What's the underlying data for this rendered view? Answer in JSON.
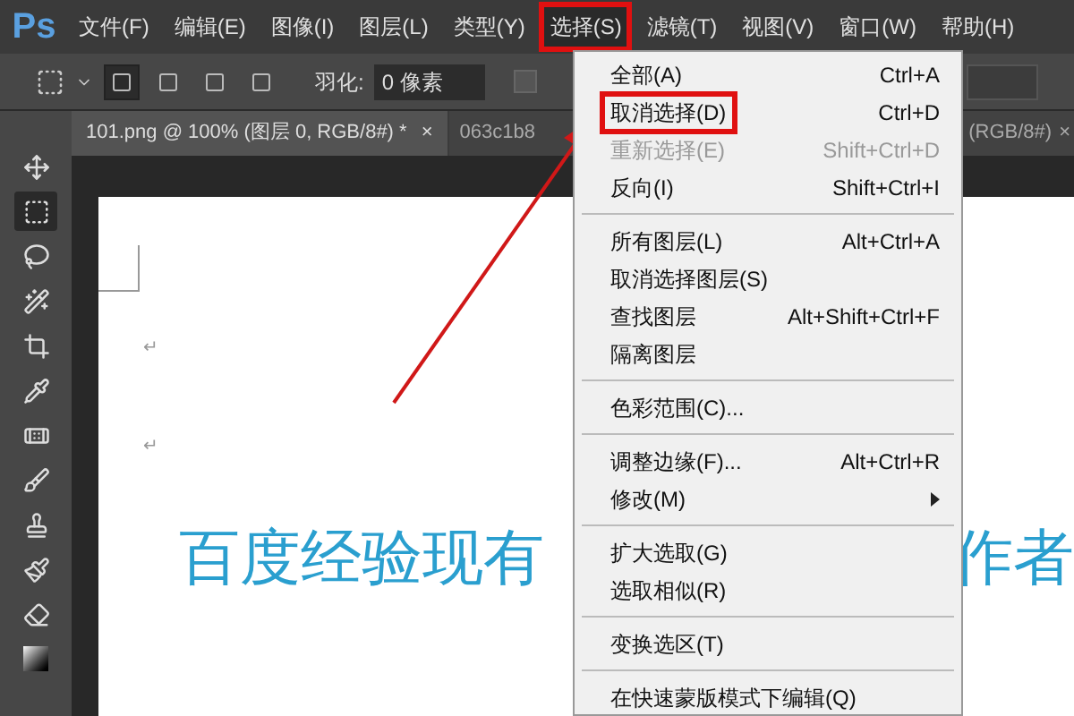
{
  "app_logo": "Ps",
  "menu_bar": [
    {
      "label": "文件(F)",
      "selected": false,
      "highlighted": false
    },
    {
      "label": "编辑(E)",
      "selected": false,
      "highlighted": false
    },
    {
      "label": "图像(I)",
      "selected": false,
      "highlighted": false
    },
    {
      "label": "图层(L)",
      "selected": false,
      "highlighted": false
    },
    {
      "label": "类型(Y)",
      "selected": false,
      "highlighted": false
    },
    {
      "label": "选择(S)",
      "selected": true,
      "highlighted": true
    },
    {
      "label": "滤镜(T)",
      "selected": false,
      "highlighted": false
    },
    {
      "label": "视图(V)",
      "selected": false,
      "highlighted": false
    },
    {
      "label": "窗口(W)",
      "selected": false,
      "highlighted": false
    },
    {
      "label": "帮助(H)",
      "selected": false,
      "highlighted": false
    }
  ],
  "options_bar": {
    "modes": [
      {
        "selected": true
      },
      {
        "selected": false
      },
      {
        "selected": false
      },
      {
        "selected": false
      }
    ],
    "feather_label": "羽化:",
    "feather_value": "0 像素",
    "antialias_checked": false
  },
  "tabs": [
    {
      "label": "101.png @ 100% (图层 0, RGB/8#) *",
      "close": "×",
      "selected": true
    },
    {
      "label": "063c1b8",
      "label_end": "(RGB/8#)",
      "close": "×",
      "selected": false
    }
  ],
  "tools": [
    {
      "kind": "move",
      "selected": false
    },
    {
      "kind": "marquee",
      "selected": true
    },
    {
      "kind": "lasso",
      "selected": false
    },
    {
      "kind": "wand",
      "selected": false
    },
    {
      "kind": "crop",
      "selected": false
    },
    {
      "kind": "eyedropper",
      "selected": false
    },
    {
      "kind": "heal",
      "selected": false
    },
    {
      "kind": "brush",
      "selected": false
    },
    {
      "kind": "stamp",
      "selected": false
    },
    {
      "kind": "history",
      "selected": false
    },
    {
      "kind": "eraser",
      "selected": false
    },
    {
      "kind": "gradient",
      "selected": false
    }
  ],
  "document": {
    "marks": [
      "↵",
      "↵"
    ],
    "text_start": "百度经验现有",
    "text_end": "作者"
  },
  "menu": {
    "sections": [
      [
        {
          "label": "全部(A)",
          "shortcut": "Ctrl+A",
          "disabled": false,
          "highlighted": false,
          "submenu": false
        },
        {
          "label": "取消选择(D)",
          "shortcut": "Ctrl+D",
          "disabled": false,
          "highlighted": true,
          "submenu": false
        },
        {
          "label": "重新选择(E)",
          "shortcut": "Shift+Ctrl+D",
          "disabled": true,
          "highlighted": false,
          "submenu": false
        },
        {
          "label": "反向(I)",
          "shortcut": "Shift+Ctrl+I",
          "disabled": false,
          "highlighted": false,
          "submenu": false
        }
      ],
      [
        {
          "label": "所有图层(L)",
          "shortcut": "Alt+Ctrl+A",
          "disabled": false,
          "highlighted": false,
          "submenu": false
        },
        {
          "label": "取消选择图层(S)",
          "disabled": false,
          "highlighted": false,
          "submenu": false
        },
        {
          "label": "查找图层",
          "shortcut": "Alt+Shift+Ctrl+F",
          "disabled": false,
          "highlighted": false,
          "submenu": false
        },
        {
          "label": "隔离图层",
          "disabled": false,
          "highlighted": false,
          "submenu": false
        }
      ],
      [
        {
          "label": "色彩范围(C)...",
          "disabled": false,
          "highlighted": false,
          "submenu": false
        }
      ],
      [
        {
          "label": "调整边缘(F)...",
          "shortcut": "Alt+Ctrl+R",
          "disabled": false,
          "highlighted": false,
          "submenu": false
        },
        {
          "label": "修改(M)",
          "disabled": false,
          "highlighted": false,
          "submenu": true
        }
      ],
      [
        {
          "label": "扩大选取(G)",
          "disabled": false,
          "highlighted": false,
          "submenu": false
        },
        {
          "label": "选取相似(R)",
          "disabled": false,
          "highlighted": false,
          "submenu": false
        }
      ],
      [
        {
          "label": "变换选区(T)",
          "disabled": false,
          "highlighted": false,
          "submenu": false
        }
      ],
      [
        {
          "label": "在快速蒙版模式下编辑(Q)",
          "disabled": false,
          "highlighted": false,
          "submenu": false
        }
      ]
    ]
  }
}
